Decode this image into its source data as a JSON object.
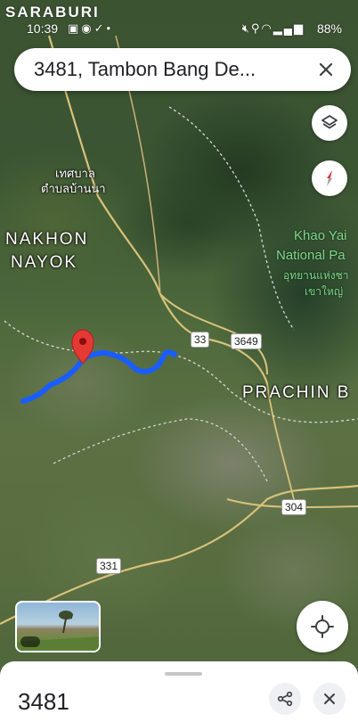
{
  "status_bar": {
    "top_label": "SARABURI",
    "time": "10:39",
    "battery": "88%",
    "left_icons": [
      "photo-icon",
      "settings-icon",
      "check-icon",
      "dot-icon"
    ],
    "right_icons": [
      "mute-icon",
      "location-icon",
      "wifi-icon",
      "signal-icon"
    ]
  },
  "search": {
    "query": "3481, Tambon Bang De..."
  },
  "map": {
    "labels": {
      "thesaban": "เทศบาล",
      "tambon": "ตำบลบ้านนา",
      "nakhon": "NAKHON",
      "nayok": "NAYOK",
      "khao_yai_1": "Khao Yai",
      "khao_yai_2": "National Pa",
      "khao_yai_th_1": "อุทยานแห่งชา",
      "khao_yai_th_2": "เขาใหญ่",
      "prachin": "PRACHIN B"
    },
    "route_shields": [
      "33",
      "3649",
      "304",
      "331"
    ],
    "route_color": "#1a5dff",
    "pin_color": "#e53935"
  },
  "sheet": {
    "title": "3481"
  }
}
